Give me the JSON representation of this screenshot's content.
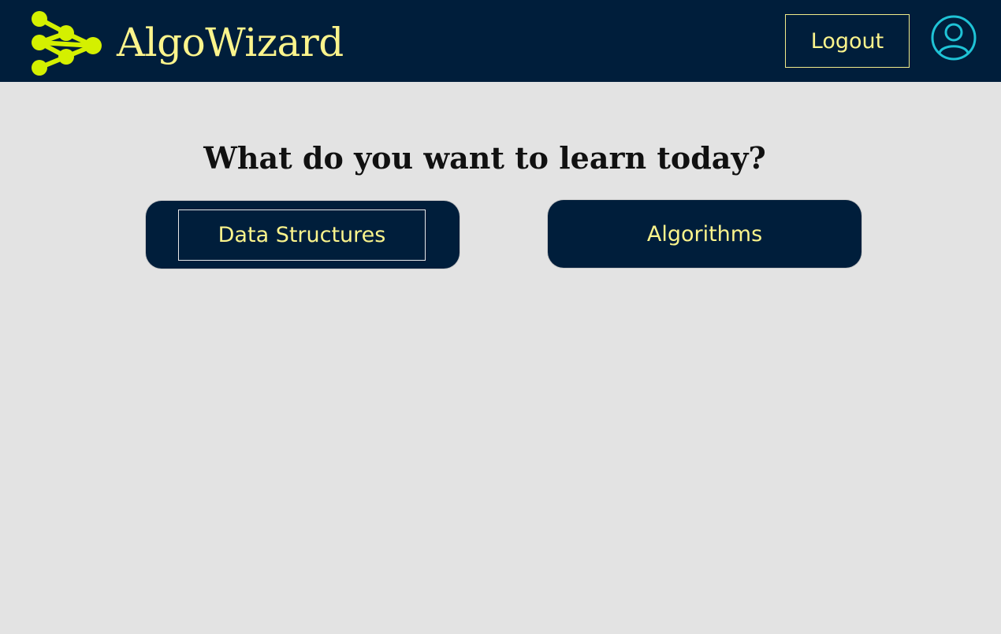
{
  "header": {
    "brand_name": "AlgoWizard",
    "logo_icon": "graph-nodes-icon",
    "logout_label": "Logout",
    "avatar_icon": "user-circle-icon"
  },
  "main": {
    "headline": "What do you want to learn today?",
    "choices": [
      {
        "label": "Data Structures",
        "focused": true
      },
      {
        "label": "Algorithms",
        "focused": false
      }
    ]
  },
  "colors": {
    "header_bg": "#001e3b",
    "page_bg": "#e3e3e3",
    "accent_text": "#fbf48c",
    "logo_green": "#d4f000",
    "avatar_cyan": "#1fc3d6"
  }
}
